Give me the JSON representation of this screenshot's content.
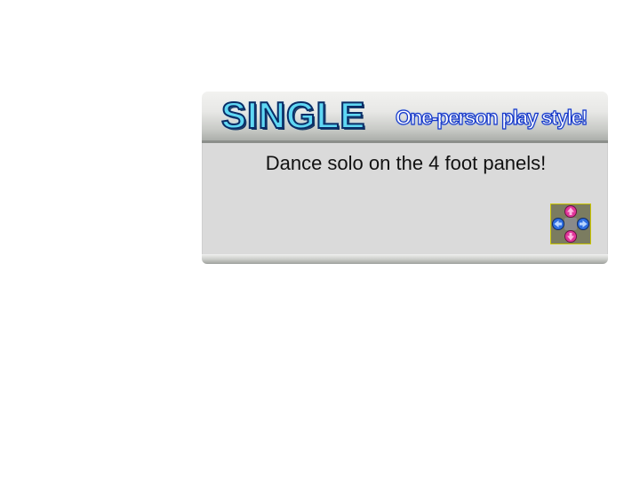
{
  "mode": {
    "title": "SINGLE",
    "subtitle": "One-person play style!",
    "description": "Dance solo on the 4 foot panels!"
  },
  "pad_icon": {
    "name": "dance-pad-4-panel-icon",
    "arrows": [
      {
        "dir": "up",
        "color": "#e2369a"
      },
      {
        "dir": "down",
        "color": "#e2369a"
      },
      {
        "dir": "left",
        "color": "#2f6ee0"
      },
      {
        "dir": "right",
        "color": "#2f6ee0"
      }
    ],
    "frame_color": "#c9c400"
  }
}
